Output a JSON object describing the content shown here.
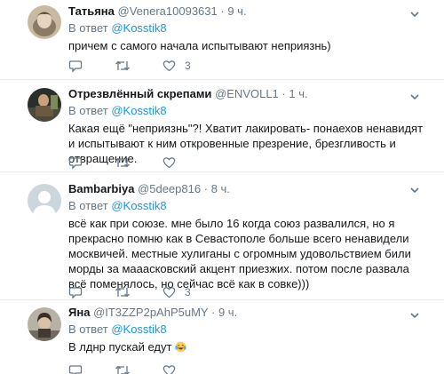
{
  "reply_prefix": "В ответ",
  "separator": "·",
  "tweets": [
    {
      "name": "Татьяна",
      "handle": "@Venera10093631",
      "time": "9 ч.",
      "mention": "@Kosstik8",
      "text": "причем с самого начала испытывают неприязнь)",
      "likes": "3"
    },
    {
      "name": "Отрезвлённый скрепами",
      "handle": "@ENVOLL1",
      "time": "1 ч.",
      "mention": "@Kosstik8",
      "text": "Какая ещё \"неприязнь\"?! Хватит лакировать- понаехов ненавидят и испытывают к ним откровенные презрение,  брезгливость и отвращение.",
      "likes": ""
    },
    {
      "name": "Bambarbiya",
      "handle": "@5deep816",
      "time": "8 ч.",
      "mention": "@Kosstik8",
      "text": "всё как при союзе. мне было 16 когда союз развалился, но я прекрасно помню как в Севастополе больше всего ненавидели москвичей. местные хулиганы с огромным удовольствием били морды за мааасковский акцент приезжих. потом после развала всё поменялось, но сейчас всё как в совке)))",
      "likes": "3"
    },
    {
      "name": "Яна",
      "handle": "@IT3ZZP2pAhP5uMY",
      "time": "9 ч.",
      "mention": "@Kosstik8",
      "text": "В лднр пускай едут",
      "emoji": "face-with-tears-of-joy",
      "likes": ""
    }
  ],
  "icons": {
    "reply": "reply-icon",
    "retweet": "retweet-icon",
    "like": "heart-icon",
    "more": "chevron-down-icon"
  },
  "colors": {
    "link": "#1b95e0",
    "muted": "#657786",
    "text": "#14171a",
    "divider": "#e6ecf0"
  }
}
